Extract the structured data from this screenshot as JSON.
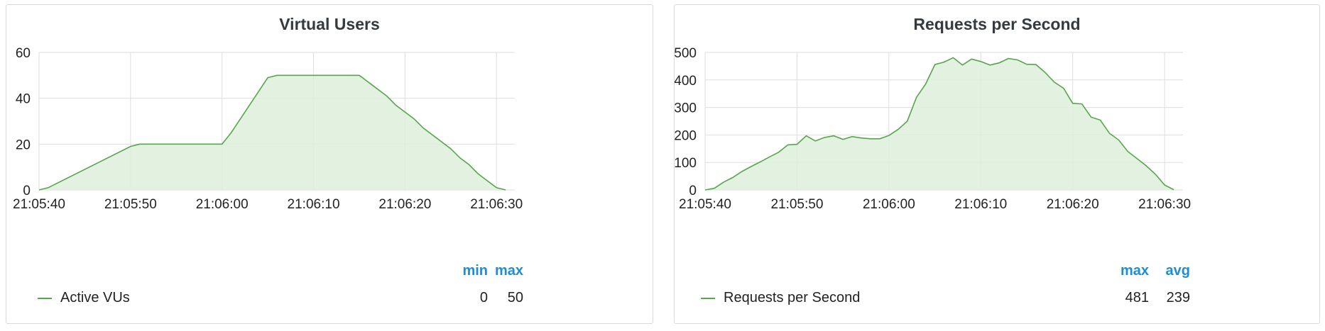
{
  "colors": {
    "series": "#56a64b",
    "fill": "#ddeedb",
    "grid": "#dedede",
    "accent": "#1f8dd6"
  },
  "panels": [
    {
      "title": "Virtual Users",
      "legend": {
        "headers": [
          "min",
          "max"
        ],
        "series_name": "Active VUs",
        "values": [
          "0",
          "50"
        ]
      }
    },
    {
      "title": "Requests per Second",
      "legend": {
        "headers": [
          "max",
          "avg"
        ],
        "series_name": "Requests per Second",
        "values": [
          "481",
          "239"
        ]
      }
    }
  ],
  "chart_data": [
    {
      "type": "area",
      "title": "Virtual Users",
      "xlabel": "",
      "ylabel": "",
      "x_ticks": [
        "21:05:40",
        "21:05:50",
        "21:06:00",
        "21:06:10",
        "21:06:20",
        "21:06:30"
      ],
      "y_ticks": [
        0,
        20,
        40,
        60
      ],
      "xlim": [
        "21:05:40",
        "21:06:32"
      ],
      "ylim": [
        0,
        60
      ],
      "grid": true,
      "legend_position": "bottom",
      "series": [
        {
          "name": "Active VUs",
          "x": [
            "21:05:40",
            "21:05:41",
            "21:05:50",
            "21:05:51",
            "21:06:00",
            "21:06:01",
            "21:06:05",
            "21:06:06",
            "21:06:15",
            "21:06:17",
            "21:06:18",
            "21:06:19",
            "21:06:20",
            "21:06:21",
            "21:06:22",
            "21:06:25",
            "21:06:26",
            "21:06:27",
            "21:06:28",
            "21:06:30",
            "21:06:31"
          ],
          "values": [
            0,
            1,
            19,
            20,
            20,
            25,
            49,
            50,
            50,
            44,
            41,
            37,
            34,
            31,
            27,
            18,
            14,
            11,
            7,
            1,
            0
          ]
        }
      ]
    },
    {
      "type": "area",
      "title": "Requests per Second",
      "xlabel": "",
      "ylabel": "",
      "x_ticks": [
        "21:05:40",
        "21:05:50",
        "21:06:00",
        "21:06:10",
        "21:06:20",
        "21:06:30"
      ],
      "y_ticks": [
        0,
        100,
        200,
        300,
        400,
        500
      ],
      "xlim": [
        "21:05:40",
        "21:06:32"
      ],
      "ylim": [
        0,
        500
      ],
      "grid": true,
      "legend_position": "bottom",
      "series": [
        {
          "name": "Requests per Second",
          "x": [
            "21:05:40",
            "21:05:41",
            "21:05:42",
            "21:05:43",
            "21:05:44",
            "21:05:45",
            "21:05:46",
            "21:05:47",
            "21:05:48",
            "21:05:49",
            "21:05:50",
            "21:05:51",
            "21:05:52",
            "21:05:53",
            "21:05:54",
            "21:05:55",
            "21:05:56",
            "21:05:57",
            "21:05:58",
            "21:05:59",
            "21:06:00",
            "21:06:01",
            "21:06:02",
            "21:06:03",
            "21:06:04",
            "21:06:05",
            "21:06:06",
            "21:06:07",
            "21:06:08",
            "21:06:09",
            "21:06:10",
            "21:06:11",
            "21:06:12",
            "21:06:13",
            "21:06:14",
            "21:06:15",
            "21:06:16",
            "21:06:17",
            "21:06:18",
            "21:06:19",
            "21:06:20",
            "21:06:21",
            "21:06:22",
            "21:06:23",
            "21:06:24",
            "21:06:25",
            "21:06:26",
            "21:06:27",
            "21:06:28",
            "21:06:29",
            "21:06:30",
            "21:06:31"
          ],
          "values": [
            0,
            6,
            28,
            45,
            67,
            85,
            102,
            120,
            137,
            164,
            166,
            197,
            178,
            191,
            197,
            184,
            194,
            189,
            186,
            186,
            198,
            220,
            250,
            337,
            385,
            456,
            465,
            481,
            454,
            476,
            467,
            454,
            462,
            478,
            473,
            457,
            456,
            427,
            392,
            370,
            315,
            313,
            265,
            254,
            206,
            182,
            140,
            114,
            88,
            57,
            18,
            1
          ]
        }
      ]
    }
  ]
}
